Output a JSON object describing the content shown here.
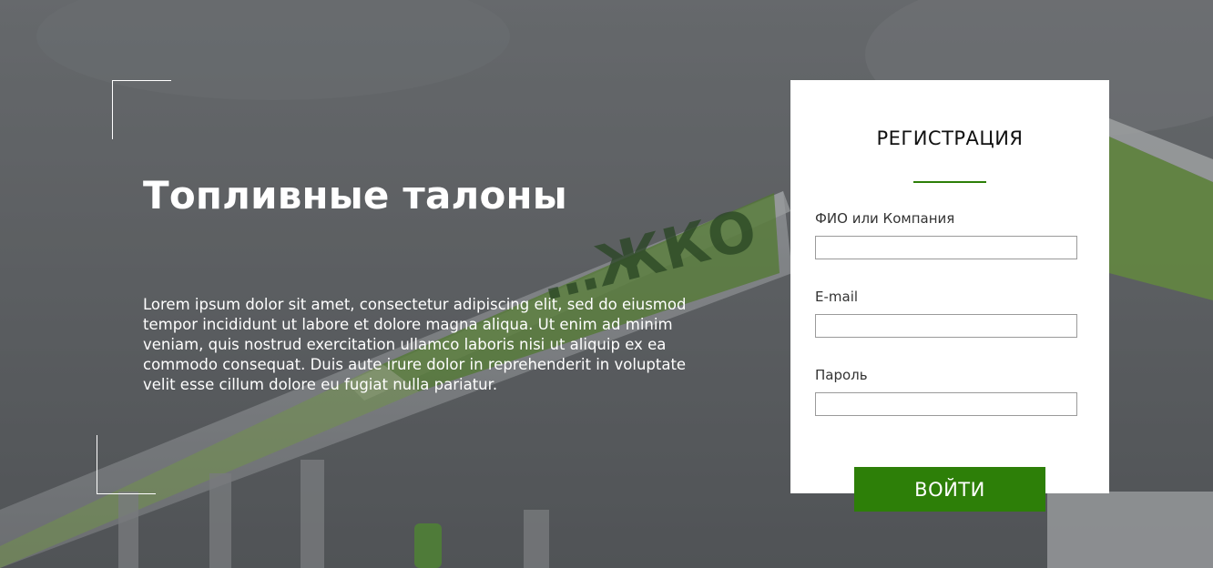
{
  "colors": {
    "accent": "#2d7f08",
    "card_bg": "#ffffff",
    "overlay_text": "#ffffff",
    "photo_sky": "#8a8d90",
    "photo_brand_green": "#7bd12c"
  },
  "background": {
    "station_sign_text": "…ЖКО"
  },
  "hero": {
    "title": "Топливные талоны",
    "description": "Lorem ipsum dolor sit amet, consectetur adipiscing elit, sed do eiusmod tempor incididunt ut labore et dolore magna aliqua. Ut enim ad minim veniam, quis nostrud exercitation ullamco laboris nisi ut aliquip ex ea commodo consequat. Duis aute irure dolor in reprehenderit in voluptate velit esse cillum dolore eu fugiat nulla pariatur."
  },
  "form": {
    "title": "РЕГИСТРАЦИЯ",
    "fields": [
      {
        "label": "ФИО или Компания",
        "value": "",
        "placeholder": ""
      },
      {
        "label": "E-mail",
        "value": "",
        "placeholder": ""
      },
      {
        "label": "Пароль",
        "value": "",
        "placeholder": ""
      }
    ],
    "submit_label": "ВОЙТИ"
  }
}
